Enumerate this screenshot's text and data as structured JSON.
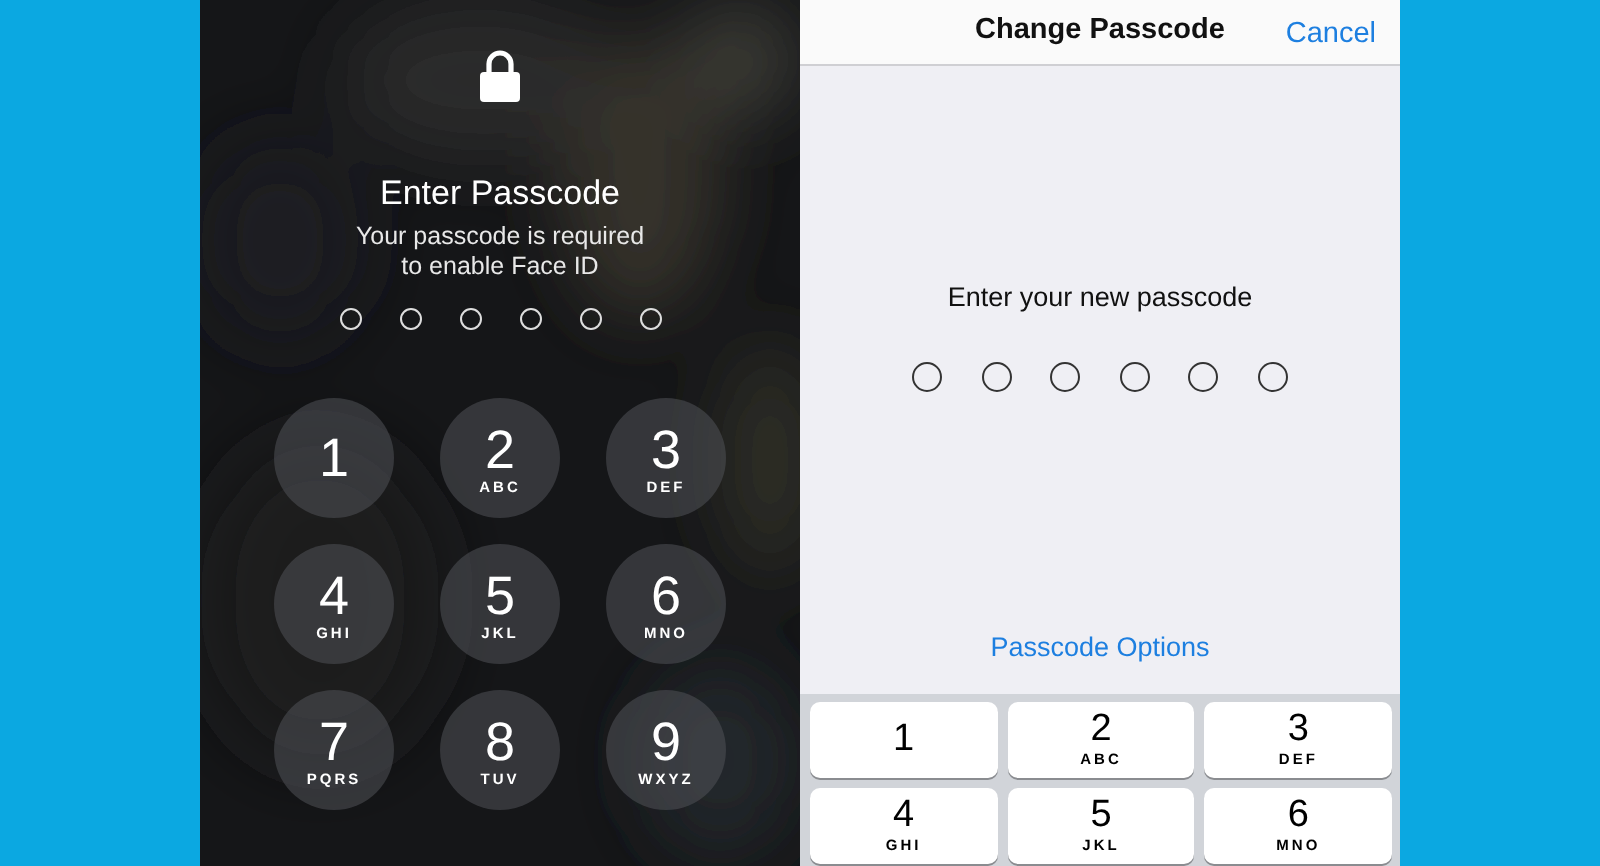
{
  "lock_screen": {
    "title": "Enter Passcode",
    "message_lines": [
      "Your passcode is required",
      "to enable Face ID"
    ],
    "dots": [
      {
        "filled": false
      },
      {
        "filled": false
      },
      {
        "filled": false
      },
      {
        "filled": false
      },
      {
        "filled": false
      },
      {
        "filled": false
      }
    ],
    "keys": [
      {
        "digit": "1"
      },
      {
        "digit": "2",
        "letters": "ABC"
      },
      {
        "digit": "3",
        "letters": "DEF"
      },
      {
        "digit": "4",
        "letters": "GHI"
      },
      {
        "digit": "5",
        "letters": "JKL"
      },
      {
        "digit": "6",
        "letters": "MNO"
      },
      {
        "digit": "7",
        "letters": "PQRS"
      },
      {
        "digit": "8",
        "letters": "TUV"
      },
      {
        "digit": "9",
        "letters": "WXYZ"
      }
    ]
  },
  "change_passcode": {
    "title": "Change Passcode",
    "cancel": "Cancel",
    "prompt": "Enter your new passcode",
    "dots": [
      {
        "filled": false
      },
      {
        "filled": false
      },
      {
        "filled": false
      },
      {
        "filled": false
      },
      {
        "filled": false
      },
      {
        "filled": false
      }
    ],
    "options_link": "Passcode Options",
    "keys": [
      {
        "digit": "1"
      },
      {
        "digit": "2",
        "letters": "ABC"
      },
      {
        "digit": "3",
        "letters": "DEF"
      },
      {
        "digit": "4",
        "letters": "GHI"
      },
      {
        "digit": "5",
        "letters": "JKL"
      },
      {
        "digit": "6",
        "letters": "MNO"
      }
    ]
  }
}
